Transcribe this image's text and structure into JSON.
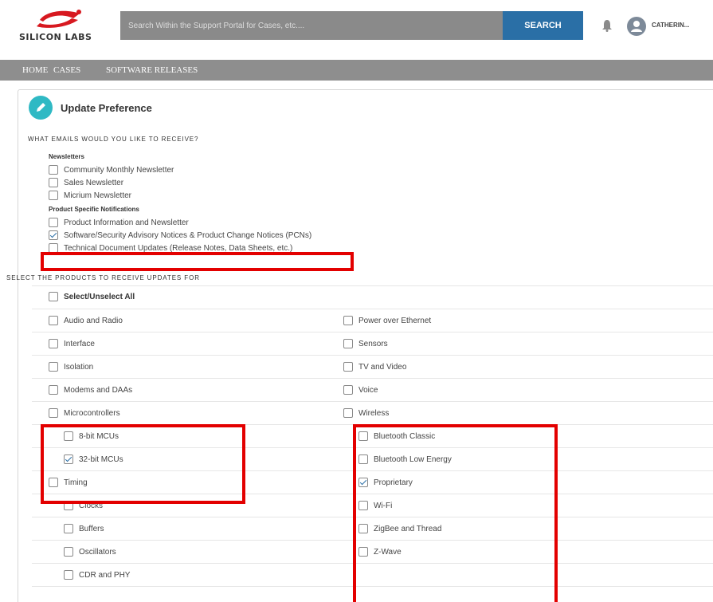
{
  "header": {
    "logo_text": "SILICON LABS",
    "search_placeholder": "Search Within the Support Portal for Cases, etc....",
    "search_button": "SEARCH",
    "user_name": "CATHERIN...",
    "accent_color": "#2a6fa6"
  },
  "nav": {
    "items": [
      "HOME",
      "CASES",
      "SOFTWARE RELEASES"
    ]
  },
  "card": {
    "title": "Update Preference",
    "emails_heading": "WHAT EMAILS WOULD YOU LIKE TO RECEIVE?",
    "newsletters_heading": "Newsletters",
    "newsletters": [
      {
        "label": "Community Monthly Newsletter",
        "checked": false
      },
      {
        "label": "Sales Newsletter",
        "checked": false
      },
      {
        "label": "Micrium Newsletter",
        "checked": false
      }
    ],
    "product_notifications_heading": "Product Specific Notifications",
    "product_notifications": [
      {
        "label": "Product Information and Newsletter",
        "checked": false
      },
      {
        "label": "Software/Security Advisory Notices & Product Change Notices (PCNs)",
        "checked": true
      },
      {
        "label": "Technical Document Updates (Release Notes, Data Sheets, etc.)",
        "checked": false
      }
    ],
    "products_heading": "SELECT THE PRODUCTS TO RECEIVE UPDATES FOR",
    "select_all": "Select/Unselect All",
    "left_products": [
      {
        "label": "Audio and Radio",
        "checked": false
      },
      {
        "label": "Interface",
        "checked": false
      },
      {
        "label": "Isolation",
        "checked": false
      },
      {
        "label": "Modems and DAAs",
        "checked": false
      },
      {
        "label": "Microcontrollers",
        "checked": false
      },
      {
        "label": "8-bit MCUs",
        "checked": false
      },
      {
        "label": "32-bit MCUs",
        "checked": true
      },
      {
        "label": "Timing",
        "checked": false
      },
      {
        "label": "Clocks",
        "checked": false
      },
      {
        "label": "Buffers",
        "checked": false
      },
      {
        "label": "Oscillators",
        "checked": false
      },
      {
        "label": "CDR and PHY",
        "checked": false
      }
    ],
    "right_products": [
      {
        "label": "Power over Ethernet",
        "checked": false
      },
      {
        "label": "Sensors",
        "checked": false
      },
      {
        "label": "TV and Video",
        "checked": false
      },
      {
        "label": "Voice",
        "checked": false
      },
      {
        "label": "Wireless",
        "checked": false
      },
      {
        "label": "Bluetooth Classic",
        "checked": false
      },
      {
        "label": "Bluetooth Low Energy",
        "checked": false
      },
      {
        "label": "Proprietary",
        "checked": true
      },
      {
        "label": "Wi-Fi",
        "checked": false
      },
      {
        "label": "ZigBee and Thread",
        "checked": false
      },
      {
        "label": "Z-Wave",
        "checked": false
      }
    ]
  },
  "highlight_color": "#e30000"
}
